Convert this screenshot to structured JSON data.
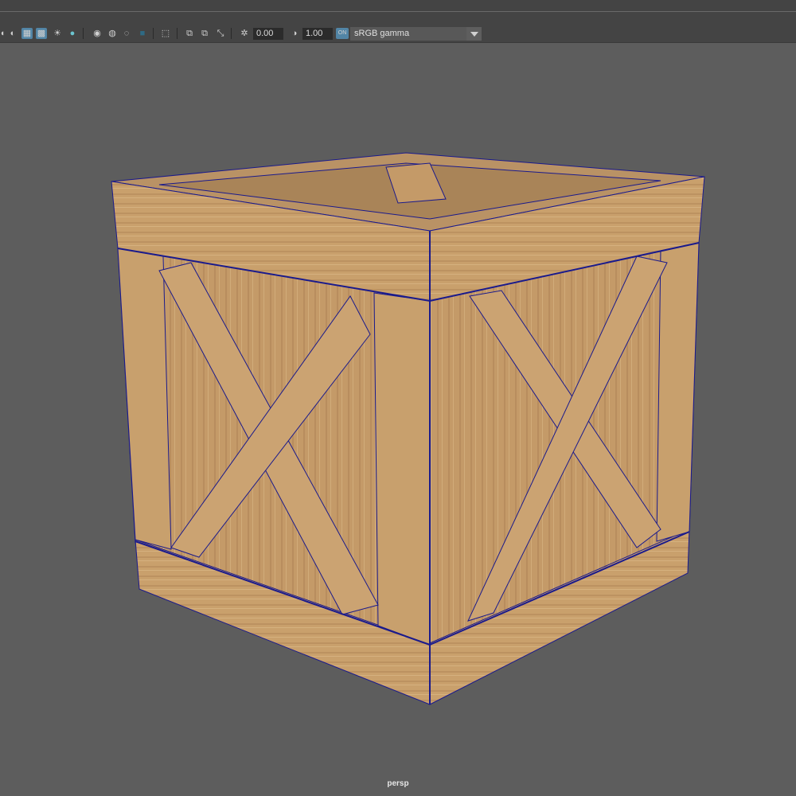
{
  "toolbar": {
    "icons": [
      "xray-icon",
      "wireframe-on-shaded-icon",
      "textured-icon",
      "lights-icon",
      "shadows-icon",
      "ambient-occlusion-icon",
      "motion-blur-icon",
      "antialiasing-icon",
      "depth-of-field-icon",
      "isolate-select-icon",
      "grid-icon",
      "camera-gate-icon",
      "resolution-gate-icon",
      "exposure-icon",
      "gamma-icon",
      "color-management-icon"
    ],
    "exposure_value": "0.00",
    "gamma_value": "1.00",
    "color_space": "sRGB gamma",
    "color_management_badge": "ON"
  },
  "viewport": {
    "camera_label": "persp",
    "background_color": "#5d5d5d",
    "wireframe_color": "#1a1a8c",
    "wood_color": "#c69c6a"
  }
}
